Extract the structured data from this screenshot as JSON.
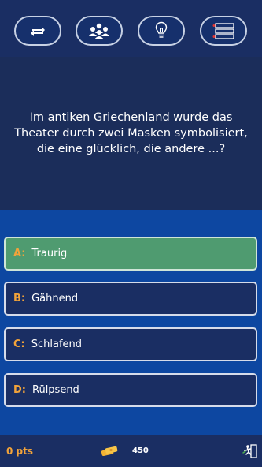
{
  "lifelines": [
    {
      "icon": "swap-icon"
    },
    {
      "icon": "audience-icon"
    },
    {
      "icon": "lightbulb-icon"
    },
    {
      "icon": "fifty-fifty-icon"
    }
  ],
  "question": {
    "text": "Im antiken Griechenland wurde das Theater durch zwei Masken symbolisiert, die eine glücklich, die andere ...?"
  },
  "answers": [
    {
      "letter": "A:",
      "text": "Traurig",
      "state": "correct"
    },
    {
      "letter": "B:",
      "text": "Gähnend",
      "state": "default"
    },
    {
      "letter": "C:",
      "text": "Schlafend",
      "state": "default"
    },
    {
      "letter": "D:",
      "text": "Rülpsend",
      "state": "default"
    }
  ],
  "footer": {
    "points": "0 pts",
    "coins": "450",
    "coins_icon": "coins-icon",
    "exit_icon": "exit-icon"
  },
  "colors": {
    "background": "#0d47a1",
    "panel": "#1b2d5a",
    "bar": "#1a2e63",
    "correct": "#4f9b70",
    "accent": "#f2a33a"
  }
}
